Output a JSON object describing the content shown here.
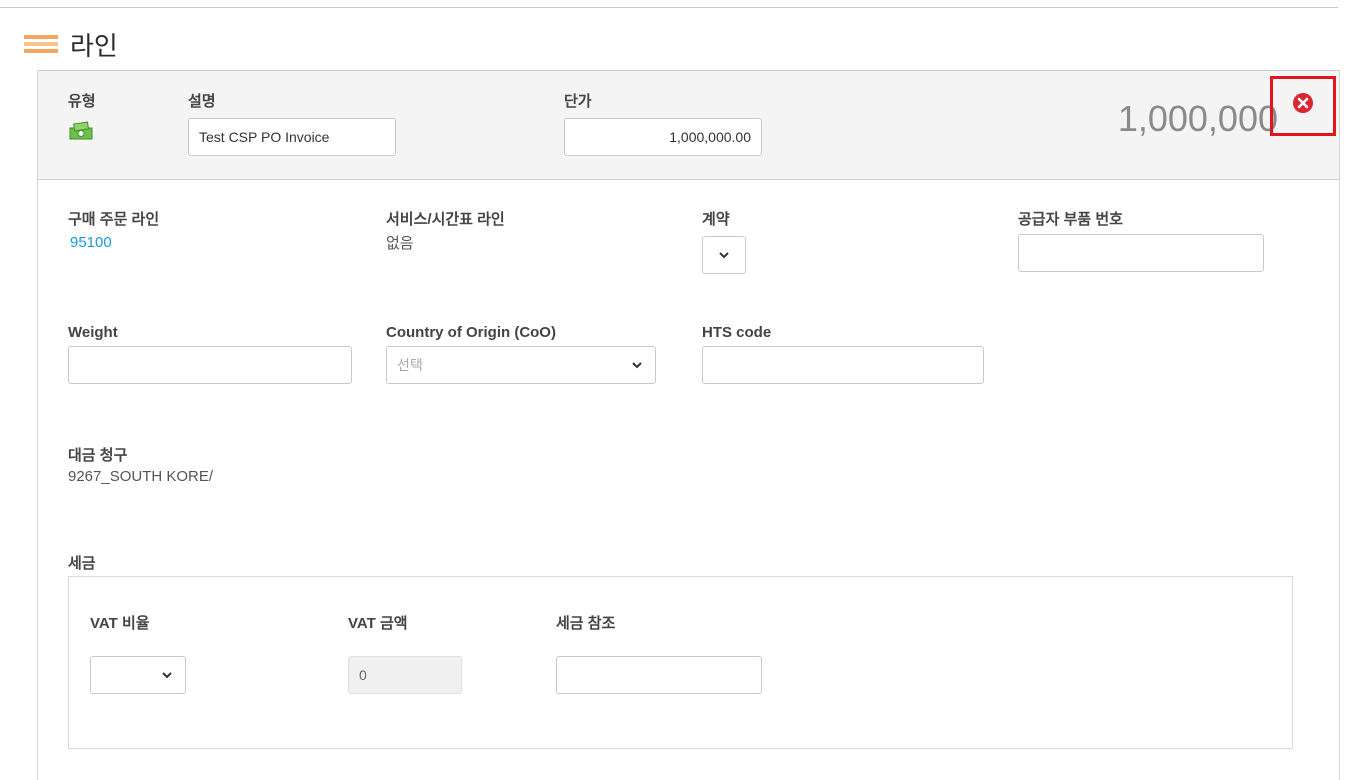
{
  "section": {
    "title": "라인"
  },
  "line": {
    "type_label": "유형",
    "description_label": "설명",
    "description_value": "Test CSP PO Invoice",
    "unit_price_label": "단가",
    "unit_price_value": "1,000,000.00",
    "total": "1,000,000"
  },
  "details": {
    "po_line_label": "구매 주문 라인",
    "po_line_value": "95100",
    "service_sheet_label": "서비스/시간표 라인",
    "service_sheet_value": "없음",
    "contract_label": "계약",
    "supplier_part_label": "공급자 부품 번호",
    "weight_label": "Weight",
    "coo_label": "Country of Origin (CoO)",
    "coo_placeholder": "선택",
    "hts_label": "HTS code",
    "billing_label": "대금 청구",
    "billing_value": "9267_SOUTH KORE/"
  },
  "tax": {
    "section_label": "세금",
    "vat_rate_label": "VAT 비율",
    "vat_amount_label": "VAT 금액",
    "vat_amount_value": "0",
    "tax_ref_label": "세금 참조"
  },
  "colors": {
    "link": "#1a9ad6",
    "remove_highlight": "#e0161f",
    "remove_icon": "#d9262f",
    "header_icon": "#f2a65e"
  },
  "icons": {
    "header": "lines-icon",
    "type": "money-icon",
    "remove": "remove-circle-icon",
    "dropdown": "chevron-down-icon"
  }
}
